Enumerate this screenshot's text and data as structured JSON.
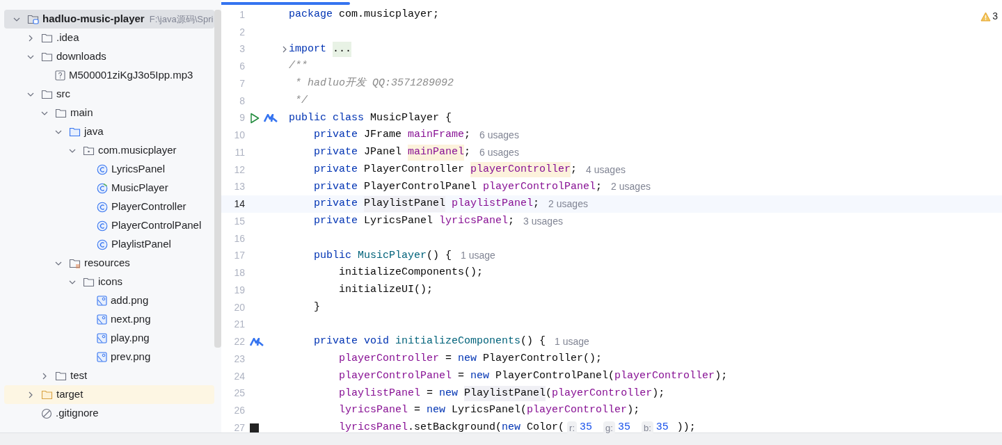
{
  "project_tree": {
    "items": [
      {
        "label": "hadluo-music-player",
        "path": "F:\\java源码\\Spri",
        "kind": "module",
        "expanded": true,
        "selected": true,
        "children": [
          {
            "label": ".idea",
            "kind": "folder",
            "expanded": false,
            "selected": false
          },
          {
            "label": "downloads",
            "kind": "folder",
            "expanded": true,
            "selected": false,
            "children": [
              {
                "label": "M500001ziKgJ3o5Ipp.mp3",
                "kind": "unknown-file",
                "selected": false
              }
            ]
          },
          {
            "label": "src",
            "kind": "folder",
            "expanded": true,
            "selected": false,
            "children": [
              {
                "label": "main",
                "kind": "folder",
                "expanded": true,
                "selected": false,
                "children": [
                  {
                    "label": "java",
                    "kind": "source-folder",
                    "expanded": true,
                    "selected": false,
                    "children": [
                      {
                        "label": "com.musicplayer",
                        "kind": "package",
                        "expanded": true,
                        "selected": false,
                        "children": [
                          {
                            "label": "LyricsPanel",
                            "kind": "class",
                            "selected": false
                          },
                          {
                            "label": "MusicPlayer",
                            "kind": "main-class",
                            "selected": false
                          },
                          {
                            "label": "PlayerController",
                            "kind": "class",
                            "selected": false
                          },
                          {
                            "label": "PlayerControlPanel",
                            "kind": "class",
                            "selected": false
                          },
                          {
                            "label": "PlaylistPanel",
                            "kind": "class",
                            "selected": false
                          }
                        ]
                      }
                    ]
                  },
                  {
                    "label": "resources",
                    "kind": "resources-folder",
                    "expanded": true,
                    "selected": false,
                    "children": [
                      {
                        "label": "icons",
                        "kind": "folder",
                        "expanded": true,
                        "selected": false,
                        "children": [
                          {
                            "label": "add.png",
                            "kind": "image",
                            "selected": false
                          },
                          {
                            "label": "next.png",
                            "kind": "image",
                            "selected": false
                          },
                          {
                            "label": "play.png",
                            "kind": "image",
                            "selected": false
                          },
                          {
                            "label": "prev.png",
                            "kind": "image",
                            "selected": false
                          }
                        ]
                      }
                    ]
                  }
                ]
              },
              {
                "label": "test",
                "kind": "folder",
                "expanded": false,
                "selected": false
              }
            ]
          },
          {
            "label": "target",
            "kind": "excluded-folder",
            "expanded": false,
            "selected": false
          },
          {
            "label": ".gitignore",
            "kind": "ignore-file",
            "selected": false
          }
        ]
      }
    ]
  },
  "editor": {
    "warnings": "3",
    "lines": [
      {
        "number": "1",
        "kind": "top",
        "current": false,
        "tokens": [
          {
            "text": "package",
            "kind": "kw"
          },
          {
            "text": " com.musicplayer;",
            "kind": "plain"
          }
        ]
      },
      {
        "number": "2",
        "kind": "blank",
        "current": false
      },
      {
        "number": "3",
        "kind": "top",
        "current": false,
        "gutter_icons": [
          {
            "kind": "fold"
          }
        ],
        "tokens": [
          {
            "text": "import",
            "kind": "kw"
          },
          {
            "text": "...",
            "kind": "folded"
          }
        ]
      },
      {
        "number": "6",
        "kind": "top",
        "current": false,
        "tokens": [
          {
            "text": "/**",
            "kind": "comment"
          }
        ]
      },
      {
        "number": "7",
        "kind": "top",
        "current": false,
        "tokens": [
          {
            "text": " * hadluo开发 QQ:3571289092",
            "kind": "comment"
          }
        ]
      },
      {
        "number": "8",
        "kind": "top",
        "current": false,
        "tokens": [
          {
            "text": " */",
            "kind": "comment"
          }
        ]
      },
      {
        "number": "9",
        "kind": "top",
        "current": false,
        "gutter_icons": [
          {
            "kind": "run"
          },
          {
            "kind": "implemented"
          }
        ],
        "tokens": [
          {
            "text": "public class",
            "kind": "kw"
          },
          {
            "text": " MusicPlayer {",
            "kind": "plain"
          }
        ]
      },
      {
        "number": "10",
        "kind": "member",
        "current": false,
        "tokens": [
          {
            "text": "private",
            "kind": "kw"
          },
          {
            "text": " JFrame ",
            "kind": "plain"
          },
          {
            "text": "mainFrame",
            "kind": "field"
          },
          {
            "text": ";",
            "kind": "plain"
          },
          {
            "text": "6 usages",
            "kind": "hint"
          }
        ]
      },
      {
        "number": "11",
        "kind": "member",
        "current": false,
        "tokens": [
          {
            "text": "private",
            "kind": "kw"
          },
          {
            "text": " JPanel ",
            "kind": "plain"
          },
          {
            "text": "mainPanel",
            "kind": "field-hl"
          },
          {
            "text": ";",
            "kind": "plain"
          },
          {
            "text": "6 usages",
            "kind": "hint"
          }
        ]
      },
      {
        "number": "12",
        "kind": "member",
        "current": false,
        "tokens": [
          {
            "text": "private",
            "kind": "kw"
          },
          {
            "text": " PlayerController ",
            "kind": "plain"
          },
          {
            "text": "playerController",
            "kind": "field-hl"
          },
          {
            "text": ";",
            "kind": "plain"
          },
          {
            "text": "4 usages",
            "kind": "hint"
          }
        ]
      },
      {
        "number": "13",
        "kind": "member",
        "current": false,
        "tokens": [
          {
            "text": "private",
            "kind": "kw"
          },
          {
            "text": " PlayerControlPanel ",
            "kind": "plain"
          },
          {
            "text": "playerControlPanel",
            "kind": "field"
          },
          {
            "text": ";",
            "kind": "plain"
          },
          {
            "text": "2 usages",
            "kind": "hint"
          }
        ]
      },
      {
        "number": "14",
        "kind": "member",
        "current": true,
        "tokens": [
          {
            "text": "private",
            "kind": "kw"
          },
          {
            "text": "PlaylistPanel",
            "kind": "type-hl"
          },
          {
            "text": " playlistPanel",
            "kind": "field"
          },
          {
            "text": ";",
            "kind": "plain"
          },
          {
            "text": "2 usages",
            "kind": "hint"
          }
        ]
      },
      {
        "number": "15",
        "kind": "member",
        "current": false,
        "tokens": [
          {
            "text": "private",
            "kind": "kw"
          },
          {
            "text": " LyricsPanel ",
            "kind": "plain"
          },
          {
            "text": "lyricsPanel",
            "kind": "field"
          },
          {
            "text": ";",
            "kind": "plain"
          },
          {
            "text": "3 usages",
            "kind": "hint"
          }
        ]
      },
      {
        "number": "16",
        "kind": "blank",
        "current": false
      },
      {
        "number": "17",
        "kind": "member",
        "current": false,
        "tokens": [
          {
            "text": "public",
            "kind": "kw"
          },
          {
            "text": "MusicPlayer",
            "kind": "method"
          },
          {
            "text": "() {",
            "kind": "plain"
          },
          {
            "text": "1 usage",
            "kind": "hint"
          }
        ]
      },
      {
        "number": "18",
        "kind": "body",
        "current": false,
        "tokens": [
          {
            "text": "initializeComponents();",
            "kind": "plain"
          }
        ]
      },
      {
        "number": "19",
        "kind": "body",
        "current": false,
        "tokens": [
          {
            "text": "initializeUI();",
            "kind": "plain"
          }
        ]
      },
      {
        "number": "20",
        "kind": "member",
        "current": false,
        "tokens": [
          {
            "text": "}",
            "kind": "plain"
          }
        ]
      },
      {
        "number": "21",
        "kind": "blank",
        "current": false
      },
      {
        "number": "22",
        "kind": "member",
        "current": false,
        "gutter_icons": [
          {
            "kind": "implemented"
          }
        ],
        "tokens": [
          {
            "text": "private void",
            "kind": "kw"
          },
          {
            "text": "initializeComponents",
            "kind": "method"
          },
          {
            "text": "() {",
            "kind": "plain"
          },
          {
            "text": "1 usage",
            "kind": "hint"
          }
        ]
      },
      {
        "number": "23",
        "kind": "body",
        "current": false,
        "tokens": [
          {
            "text": "playerController",
            "kind": "field"
          },
          {
            "text": " = ",
            "kind": "plain"
          },
          {
            "text": "new",
            "kind": "kw"
          },
          {
            "text": " PlayerController();",
            "kind": "plain"
          }
        ]
      },
      {
        "number": "24",
        "kind": "body",
        "current": false,
        "tokens": [
          {
            "text": "playerControlPanel",
            "kind": "field"
          },
          {
            "text": " = ",
            "kind": "plain"
          },
          {
            "text": "new",
            "kind": "kw"
          },
          {
            "text": " PlayerControlPanel(",
            "kind": "plain"
          },
          {
            "text": "playerController",
            "kind": "field"
          },
          {
            "text": ");",
            "kind": "plain"
          }
        ]
      },
      {
        "number": "25",
        "kind": "body",
        "current": false,
        "tokens": [
          {
            "text": "playlistPanel",
            "kind": "field"
          },
          {
            "text": " = ",
            "kind": "plain"
          },
          {
            "text": "new",
            "kind": "kw"
          },
          {
            "text": "PlaylistPanel",
            "kind": "type-hl"
          },
          {
            "text": "(",
            "kind": "plain"
          },
          {
            "text": "playerController",
            "kind": "field"
          },
          {
            "text": ");",
            "kind": "plain"
          }
        ]
      },
      {
        "number": "26",
        "kind": "body",
        "current": false,
        "tokens": [
          {
            "text": "lyricsPanel",
            "kind": "field"
          },
          {
            "text": " = ",
            "kind": "plain"
          },
          {
            "text": "new",
            "kind": "kw"
          },
          {
            "text": " LyricsPanel(",
            "kind": "plain"
          },
          {
            "text": "playerController",
            "kind": "field"
          },
          {
            "text": ");",
            "kind": "plain"
          }
        ]
      },
      {
        "number": "27",
        "kind": "body",
        "current": false,
        "gutter_icons": [
          {
            "kind": "swatch"
          }
        ],
        "tokens": [
          {
            "text": "lyricsPanel",
            "kind": "field"
          },
          {
            "text": ".setBackground(",
            "kind": "plain"
          },
          {
            "text": "new",
            "kind": "kw"
          },
          {
            "text": " Color(",
            "kind": "plain"
          },
          {
            "text": "r:",
            "kind": "param"
          },
          {
            "text": "35",
            "kind": "number"
          },
          {
            "text": "g:",
            "kind": "param"
          },
          {
            "text": "35",
            "kind": "number"
          },
          {
            "text": "b:",
            "kind": "param"
          },
          {
            "text": "35",
            "kind": "number"
          },
          {
            "text": "));",
            "kind": "plain"
          }
        ]
      }
    ]
  }
}
